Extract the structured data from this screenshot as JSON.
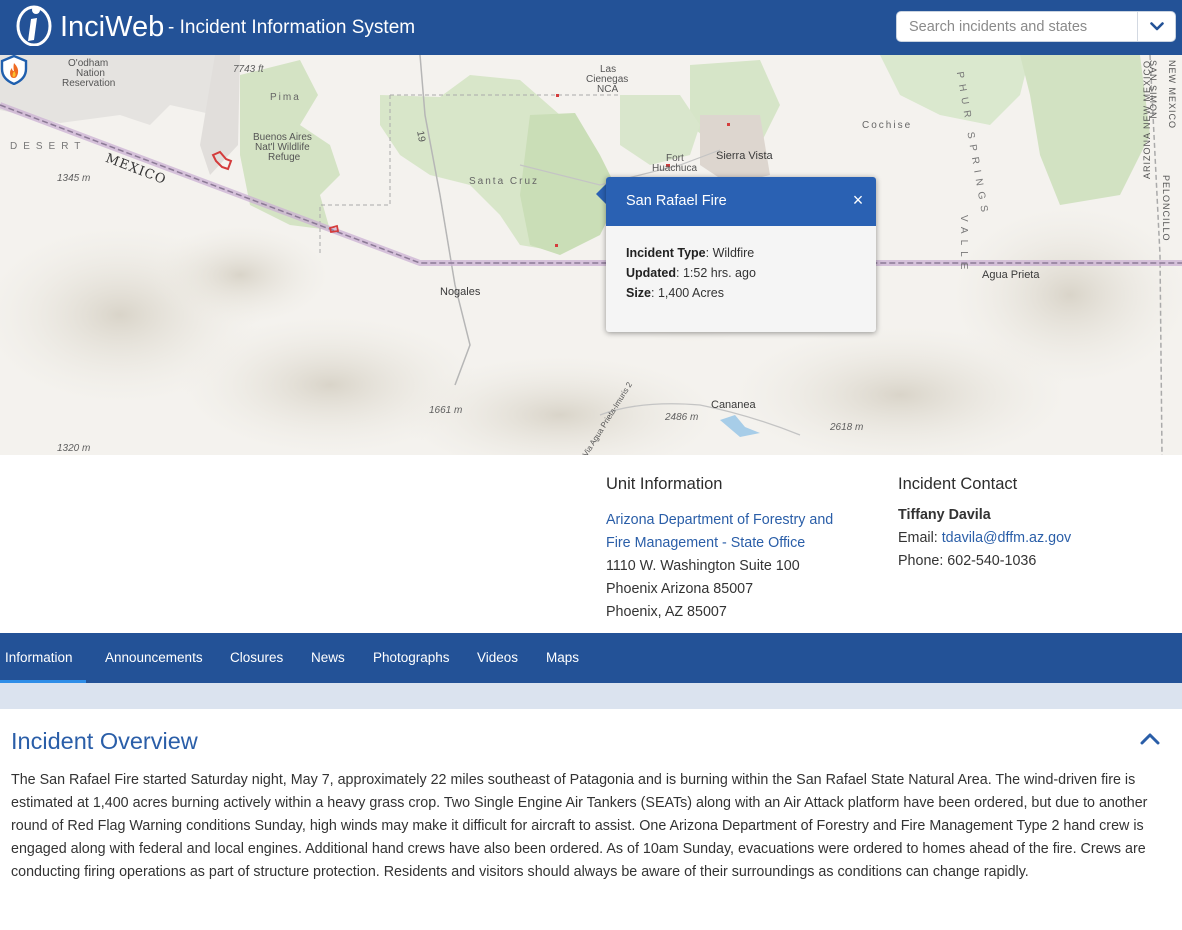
{
  "header": {
    "brand": "InciWeb",
    "tagline": "- Incident Information System",
    "search_placeholder": "Search incidents and states"
  },
  "map": {
    "labels": {
      "odham": "O'odham",
      "nation": "Nation",
      "reservation": "Reservation",
      "elev_7743": "7743 ft",
      "pima": "Pima",
      "las_cienegas_1": "Las",
      "las_cienegas_2": "Cienegas",
      "las_cienegas_3": "NCA",
      "cochise": "Cochise",
      "desert": "DESERT",
      "buenos_1": "Buenos Aires",
      "buenos_2": "Nat'l Wildlife",
      "buenos_3": "Refuge",
      "mexico": "MEXICO",
      "elev_1345": "1345 m",
      "fort_1": "Fort",
      "fort_2": "Huachuca",
      "sierra_vista": "Sierra Vista",
      "santa_cruz": "Santa Cruz",
      "route_19": "19",
      "sulphur": "PHUR SPRINGS",
      "valle": "VALLE",
      "agua_prieta": "Agua Prieta",
      "nogales": "Nogales",
      "cananea": "Cananea",
      "elev_1661": "1661 m",
      "elev_2486": "2486 m",
      "elev_2618": "2618 m",
      "elev_1320": "1320 m",
      "arizona_nm": "ARIZONA  NEW MEXICO",
      "simon": "SAN SIMON",
      "new_mexico": "NEW MEXICO",
      "peloncillo": "PELONCILLO",
      "route_2": "Via Agua Prieta-Imuris 2"
    }
  },
  "popup": {
    "title": "San Rafael Fire",
    "close": "×",
    "type_label": "Incident Type",
    "type_value": ": Wildfire",
    "updated_label": "Updated",
    "updated_value": ": 1:52 hrs. ago",
    "size_label": "Size",
    "size_value": ": 1,400 Acres"
  },
  "unit": {
    "heading": "Unit Information",
    "link_line1": "Arizona Department of Forestry and",
    "link_line2": "Fire Management - State Office",
    "address1": "1110 W. Washington Suite 100",
    "address2": "Phoenix Arizona 85007",
    "address3": "Phoenix, AZ 85007"
  },
  "contact": {
    "heading": "Incident Contact",
    "name": "Tiffany Davila",
    "email_label": "Email: ",
    "email": "tdavila@dffm.az.gov",
    "phone": "Phone: 602-540-1036"
  },
  "tabs": [
    "Information",
    "Announcements",
    "Closures",
    "News",
    "Photographs",
    "Videos",
    "Maps"
  ],
  "overview": {
    "title": "Incident Overview",
    "body": "The San Rafael Fire started Saturday night, May 7, approximately 22 miles southeast of Patagonia and is burning within the San Rafael State Natural Area. The wind-driven fire is estimated at 1,400 acres burning actively within a heavy grass crop. Two Single Engine Air Tankers (SEATs) along with an Air Attack platform have been ordered, but due to another round of Red Flag Warning conditions Sunday, high winds may make it difficult for aircraft to assist. One Arizona Department of Forestry and Fire Management Type 2 hand crew is engaged along with federal and local engines. Additional hand crews have also been ordered. As of 10am Sunday, evacuations were ordered to homes ahead of the fire. Crews are conducting firing operations as part of structure protection. Residents and visitors should always be aware of their surroundings as conditions can change rapidly."
  },
  "colors": {
    "header_bg": "#235297",
    "link": "#2a5ea8",
    "popup_header": "#2a61b3",
    "tab_active": "#2f8ee8"
  }
}
